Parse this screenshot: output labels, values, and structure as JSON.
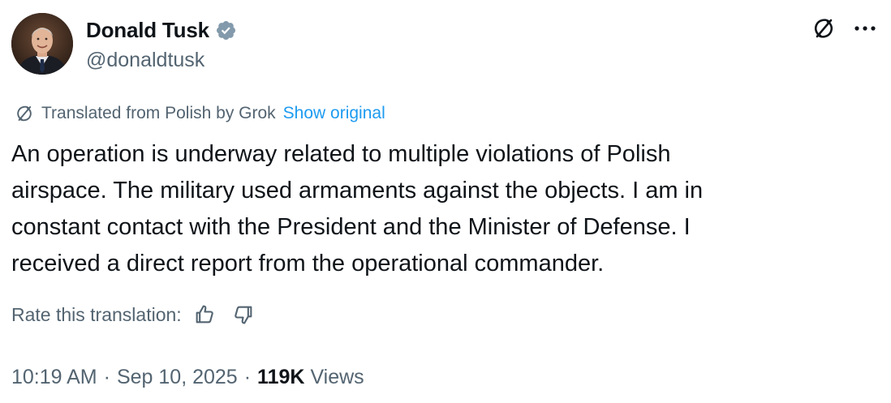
{
  "author": {
    "display_name": "Donald Tusk",
    "handle": "@donaldtusk",
    "verified_badge": "verified-badge-icon"
  },
  "header_actions": {
    "grok_icon": "grok-icon",
    "more_icon": "more-icon"
  },
  "translation": {
    "notice": "Translated from Polish by Grok",
    "show_original_label": "Show original"
  },
  "tweet": {
    "lines": [
      "An operation is underway related to multiple violations of Polish",
      "airspace. The military used armaments against the objects. I am in",
      "constant contact with the President and the Minister of Defense. I",
      "received a direct report from the operational commander."
    ]
  },
  "rating": {
    "label": "Rate this translation:",
    "thumbs_up_icon": "thumbs-up-icon",
    "thumbs_down_icon": "thumbs-down-icon"
  },
  "meta": {
    "time": "10:19 AM",
    "separator": "·",
    "date": "Sep 10, 2025",
    "views_count": "119K",
    "views_label": "Views"
  },
  "colors": {
    "text_primary": "#0f1419",
    "text_secondary": "#536471",
    "link": "#1d9bf0",
    "verified": "#829aab"
  }
}
